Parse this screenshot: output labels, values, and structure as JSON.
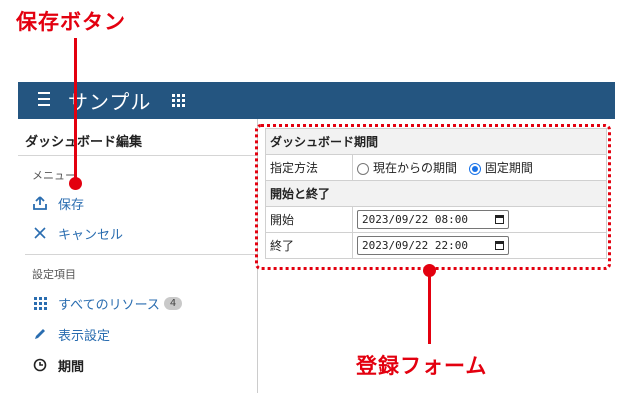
{
  "callouts": {
    "save": "保存ボタン",
    "form": "登録フォーム"
  },
  "header": {
    "title": "サンプル",
    "menu_icon": "hamburger-icon",
    "apps_icon": "apps-grid-icon",
    "bg_color": "#245580"
  },
  "sidebar": {
    "title": "ダッシュボード編集",
    "menu_section": "メニュー",
    "menu_items": [
      {
        "label": "保存",
        "icon": "upload-icon"
      },
      {
        "label": "キャンセル",
        "icon": "close-icon"
      }
    ],
    "settings_section": "設定項目",
    "settings_items": [
      {
        "label": "すべてのリソース",
        "badge": "4",
        "icon": "grid-icon"
      },
      {
        "label": "表示設定",
        "icon": "pencil-icon"
      },
      {
        "label": "期間",
        "icon": "clock-icon"
      }
    ]
  },
  "form": {
    "section_title": "ダッシュボード期間",
    "method_label": "指定方法",
    "options": [
      {
        "label": "現在からの期間",
        "checked": false
      },
      {
        "label": "固定期間",
        "checked": true
      }
    ],
    "range_title": "開始と終了",
    "start_label": "開始",
    "start_value": "2023/09/22 08:00",
    "end_label": "終了",
    "end_value": "2023/09/22 22:00"
  },
  "accent_color": "#e3000f"
}
